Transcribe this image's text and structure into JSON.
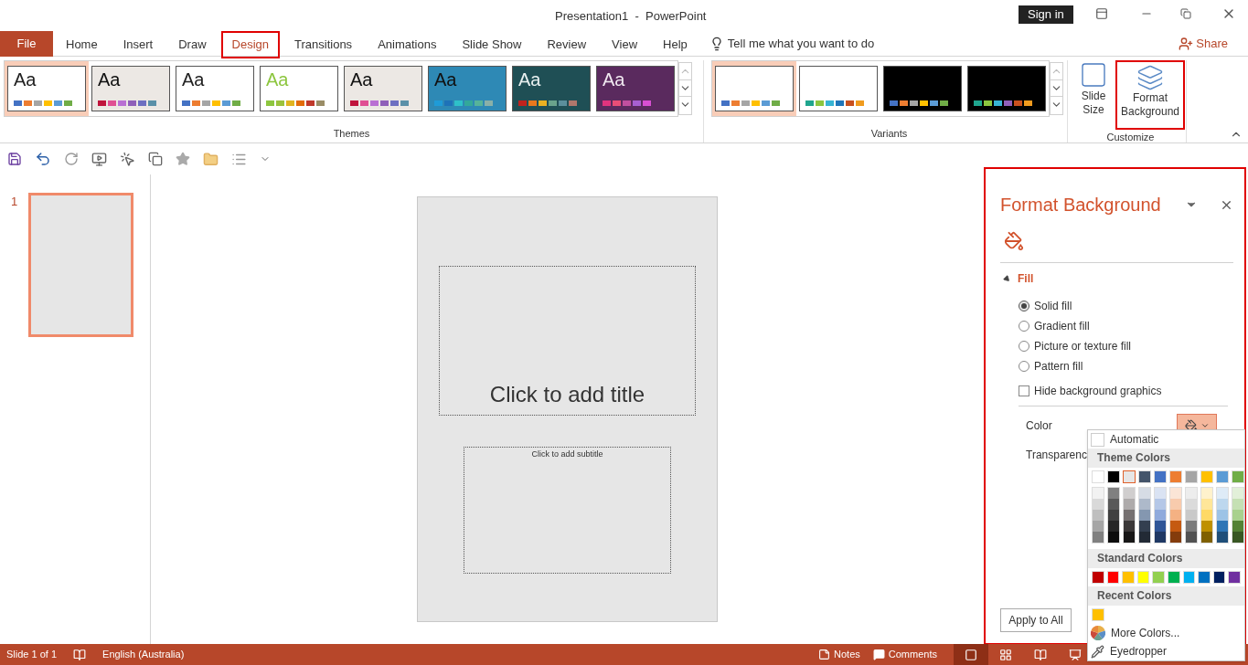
{
  "window": {
    "title": "Presentation1  -  PowerPoint",
    "sign_in": "Sign in"
  },
  "tabs": [
    {
      "label": "File",
      "kind": "file",
      "selected": false,
      "highlighted": false
    },
    {
      "label": "Home",
      "kind": "tab",
      "selected": false,
      "highlighted": false
    },
    {
      "label": "Insert",
      "kind": "tab",
      "selected": false,
      "highlighted": false
    },
    {
      "label": "Draw",
      "kind": "tab",
      "selected": false,
      "highlighted": false
    },
    {
      "label": "Design",
      "kind": "tab",
      "selected": true,
      "highlighted": true
    },
    {
      "label": "Transitions",
      "kind": "tab",
      "selected": false,
      "highlighted": false
    },
    {
      "label": "Animations",
      "kind": "tab",
      "selected": false,
      "highlighted": false
    },
    {
      "label": "Slide Show",
      "kind": "tab",
      "selected": false,
      "highlighted": false
    },
    {
      "label": "Review",
      "kind": "tab",
      "selected": false,
      "highlighted": false
    },
    {
      "label": "View",
      "kind": "tab",
      "selected": false,
      "highlighted": false
    },
    {
      "label": "Help",
      "kind": "tab",
      "selected": false,
      "highlighted": false
    }
  ],
  "tell_me": "Tell me what you want to do",
  "share": "Share",
  "themes": {
    "label": "Themes",
    "items": [
      {
        "sample": {
          "text": "Aa",
          "color": "#222222"
        },
        "background": {
          "color": "#ffffff"
        },
        "selected": true,
        "swatches": [
          {
            "color": "#4472c4"
          },
          {
            "color": "#ed7d31"
          },
          {
            "color": "#a5a5a5"
          },
          {
            "color": "#ffc000"
          },
          {
            "color": "#5b9bd5"
          },
          {
            "color": "#70ad47"
          }
        ]
      },
      {
        "sample": {
          "text": "Aa",
          "color": "#111111"
        },
        "background": {
          "color": "#ece8e4"
        },
        "selected": false,
        "swatches": [
          {
            "color": "#c0143c"
          },
          {
            "color": "#e04f93"
          },
          {
            "color": "#b96fd3"
          },
          {
            "color": "#8f5fb9"
          },
          {
            "color": "#6d6fc1"
          },
          {
            "color": "#5a90a8"
          }
        ]
      },
      {
        "sample": {
          "text": "Aa",
          "color": "#222222"
        },
        "background": {
          "color": "#ffffff"
        },
        "selected": false,
        "swatches": [
          {
            "color": "#4472c4"
          },
          {
            "color": "#ed7d31"
          },
          {
            "color": "#a5a5a5"
          },
          {
            "color": "#ffc000"
          },
          {
            "color": "#5b9bd5"
          },
          {
            "color": "#70ad47"
          }
        ]
      },
      {
        "sample": {
          "text": "Aa",
          "color": "#8dc63f"
        },
        "background": {
          "color": "#ffffff"
        },
        "selected": false,
        "swatches": [
          {
            "color": "#8dc63f"
          },
          {
            "color": "#9bc23c"
          },
          {
            "color": "#e0b420"
          },
          {
            "color": "#e36c0a"
          },
          {
            "color": "#c0392b"
          },
          {
            "color": "#9a8d66"
          }
        ]
      },
      {
        "sample": {
          "text": "Aa",
          "color": "#111111"
        },
        "background": {
          "color": "#ece8e4"
        },
        "selected": false,
        "swatches": [
          {
            "color": "#c0143c"
          },
          {
            "color": "#e04f93"
          },
          {
            "color": "#b96fd3"
          },
          {
            "color": "#8f5fb9"
          },
          {
            "color": "#6d6fc1"
          },
          {
            "color": "#5a90a8"
          }
        ]
      },
      {
        "sample": {
          "text": "Aa",
          "color": "#111111"
        },
        "background": {
          "color": "#2e89b5"
        },
        "selected": false,
        "swatches": [
          {
            "color": "#1f9bd7"
          },
          {
            "color": "#1e72b8"
          },
          {
            "color": "#2ec0c9"
          },
          {
            "color": "#33a89a"
          },
          {
            "color": "#56b39a"
          },
          {
            "color": "#8ab0a8"
          }
        ]
      },
      {
        "sample": {
          "text": "Aa",
          "color": "#e8f0f0"
        },
        "background": {
          "color": "#1f4f55"
        },
        "selected": false,
        "swatches": [
          {
            "color": "#c0231e"
          },
          {
            "color": "#e8781d"
          },
          {
            "color": "#e9b122"
          },
          {
            "color": "#6aa38c"
          },
          {
            "color": "#5b8f9c"
          },
          {
            "color": "#b0776c"
          }
        ]
      },
      {
        "sample": {
          "text": "Aa",
          "color": "#f0e8f0"
        },
        "background": {
          "color": "#5a2a5e"
        },
        "selected": false,
        "swatches": [
          {
            "color": "#e1337e"
          },
          {
            "color": "#e94e77"
          },
          {
            "color": "#c14f9f"
          },
          {
            "color": "#a85fd2"
          },
          {
            "color": "#d84fd3"
          }
        ]
      }
    ]
  },
  "variants": {
    "label": "Variants",
    "items": [
      {
        "background": {
          "color": "#ffffff"
        },
        "selected": true,
        "swatches": [
          {
            "color": "#4472c4"
          },
          {
            "color": "#ed7d31"
          },
          {
            "color": "#a5a5a5"
          },
          {
            "color": "#ffc000"
          },
          {
            "color": "#5b9bd5"
          },
          {
            "color": "#70ad47"
          }
        ]
      },
      {
        "background": {
          "color": "#ffffff"
        },
        "selected": false,
        "swatches": [
          {
            "color": "#1fa58e"
          },
          {
            "color": "#8cc63f"
          },
          {
            "color": "#37b4d4"
          },
          {
            "color": "#1f75b9"
          },
          {
            "color": "#c8501e"
          },
          {
            "color": "#f09b1e"
          }
        ]
      },
      {
        "background": {
          "color": "#000000"
        },
        "selected": false,
        "swatches": [
          {
            "color": "#4472c4"
          },
          {
            "color": "#ed7d31"
          },
          {
            "color": "#a5a5a5"
          },
          {
            "color": "#ffc000"
          },
          {
            "color": "#5b9bd5"
          },
          {
            "color": "#70ad47"
          }
        ]
      },
      {
        "background": {
          "color": "#000000"
        },
        "selected": false,
        "swatches": [
          {
            "color": "#1fa58e"
          },
          {
            "color": "#8cc63f"
          },
          {
            "color": "#37b4d4"
          },
          {
            "color": "#8f5fb9"
          },
          {
            "color": "#c8501e"
          },
          {
            "color": "#f09b1e"
          }
        ]
      }
    ]
  },
  "customize": {
    "label": "Customize",
    "slide_size": "Slide Size",
    "format_background": "Format Background",
    "highlighted": true
  },
  "slides": [
    {
      "number": "1",
      "selected": true
    }
  ],
  "slide": {
    "title_placeholder": "Click to add title",
    "subtitle_placeholder": "Click to add subtitle"
  },
  "pane": {
    "title": "Format Background",
    "highlighted": true,
    "section": "Fill",
    "expanded": true,
    "fill_options": [
      {
        "label": "Solid fill",
        "selected": true
      },
      {
        "label": "Gradient fill",
        "selected": false
      },
      {
        "label": "Picture or texture fill",
        "selected": false
      },
      {
        "label": "Pattern fill",
        "selected": false
      }
    ],
    "hide_graphics": {
      "label": "Hide background graphics",
      "checked": false
    },
    "color_label": "Color",
    "transparency_label": "Transparenc",
    "apply_button": "Apply to All"
  },
  "color_menu": {
    "automatic": "Automatic",
    "theme_heading": "Theme Colors",
    "theme_colors": [
      {
        "color": "#ffffff",
        "selected": false,
        "shades": [
          {
            "color": "#f2f2f2"
          },
          {
            "color": "#d9d9d9"
          },
          {
            "color": "#bfbfbf"
          },
          {
            "color": "#a6a6a6"
          },
          {
            "color": "#808080"
          }
        ]
      },
      {
        "color": "#000000",
        "selected": false,
        "shades": [
          {
            "color": "#808080"
          },
          {
            "color": "#595959"
          },
          {
            "color": "#404040"
          },
          {
            "color": "#262626"
          },
          {
            "color": "#0d0d0d"
          }
        ]
      },
      {
        "color": "#e7e6e6",
        "selected": true,
        "shades": [
          {
            "color": "#d0cece"
          },
          {
            "color": "#aeabab"
          },
          {
            "color": "#767171"
          },
          {
            "color": "#3b3838"
          },
          {
            "color": "#181717"
          }
        ]
      },
      {
        "color": "#44546a",
        "selected": false,
        "shades": [
          {
            "color": "#d6dce5"
          },
          {
            "color": "#adb9ca"
          },
          {
            "color": "#8497b0"
          },
          {
            "color": "#333f50"
          },
          {
            "color": "#222a35"
          }
        ]
      },
      {
        "color": "#4472c4",
        "selected": false,
        "shades": [
          {
            "color": "#dae3f3"
          },
          {
            "color": "#b4c7e7"
          },
          {
            "color": "#8faadc"
          },
          {
            "color": "#2f5597"
          },
          {
            "color": "#1f3864"
          }
        ]
      },
      {
        "color": "#ed7d31",
        "selected": false,
        "shades": [
          {
            "color": "#fbe5d6"
          },
          {
            "color": "#f8cbad"
          },
          {
            "color": "#f4b183"
          },
          {
            "color": "#c55a11"
          },
          {
            "color": "#843c0c"
          }
        ]
      },
      {
        "color": "#a5a5a5",
        "selected": false,
        "shades": [
          {
            "color": "#ededed"
          },
          {
            "color": "#dbdbdb"
          },
          {
            "color": "#c9c9c9"
          },
          {
            "color": "#7b7b7b"
          },
          {
            "color": "#525252"
          }
        ]
      },
      {
        "color": "#ffc000",
        "selected": false,
        "shades": [
          {
            "color": "#fff2cc"
          },
          {
            "color": "#ffe699"
          },
          {
            "color": "#ffd966"
          },
          {
            "color": "#bf9000"
          },
          {
            "color": "#7f6000"
          }
        ]
      },
      {
        "color": "#5b9bd5",
        "selected": false,
        "shades": [
          {
            "color": "#deebf7"
          },
          {
            "color": "#bdd7ee"
          },
          {
            "color": "#9dc3e6"
          },
          {
            "color": "#2e75b6"
          },
          {
            "color": "#1f4e79"
          }
        ]
      },
      {
        "color": "#70ad47",
        "selected": false,
        "shades": [
          {
            "color": "#e2f0d9"
          },
          {
            "color": "#c5e0b4"
          },
          {
            "color": "#a9d18e"
          },
          {
            "color": "#548235"
          },
          {
            "color": "#385723"
          }
        ]
      }
    ],
    "standard_heading": "Standard Colors",
    "standard_colors": [
      {
        "color": "#c00000"
      },
      {
        "color": "#ff0000"
      },
      {
        "color": "#ffc000"
      },
      {
        "color": "#ffff00"
      },
      {
        "color": "#92d050"
      },
      {
        "color": "#00b050"
      },
      {
        "color": "#00b0f0"
      },
      {
        "color": "#0070c0"
      },
      {
        "color": "#002060"
      },
      {
        "color": "#7030a0"
      }
    ],
    "recent_heading": "Recent Colors",
    "recent_colors": [
      {
        "color": "#ffc000"
      }
    ],
    "more_colors": "More Colors...",
    "eyedropper": "Eyedropper"
  },
  "status_bar": {
    "slide_count": "Slide 1 of 1",
    "language": "English (Australia)",
    "notes": "Notes",
    "comments": "Comments",
    "views": [
      {
        "kind": "normal",
        "selected": true
      },
      {
        "kind": "sorter",
        "selected": false
      },
      {
        "kind": "reading",
        "selected": false
      },
      {
        "kind": "slideshow",
        "selected": false
      }
    ]
  }
}
